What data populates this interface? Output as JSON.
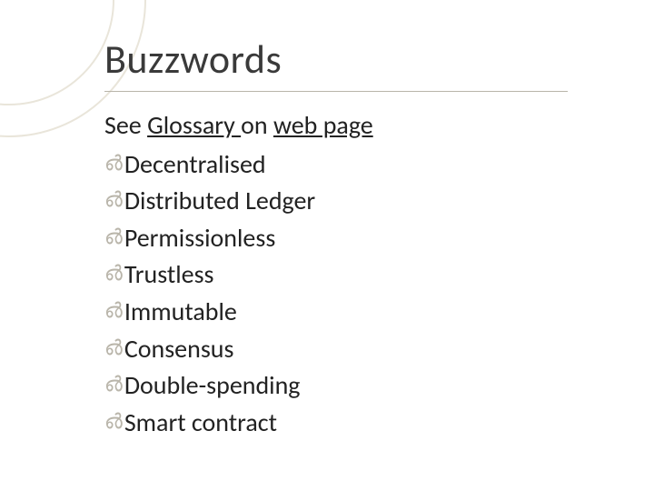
{
  "title": "Buzzwords",
  "see_line": {
    "prefix": "See ",
    "glossary_link": "Glossary ",
    "mid": "on ",
    "webpage_link": "web page"
  },
  "bullet_glyph": "൴",
  "items": [
    "Decentralised",
    "Distributed Ledger",
    "Permissionless",
    "Trustless",
    "Immutable",
    "Consensus",
    "Double-spending",
    "Smart contract"
  ],
  "colors": {
    "accent": "#b9b5aa",
    "text": "#333333"
  }
}
